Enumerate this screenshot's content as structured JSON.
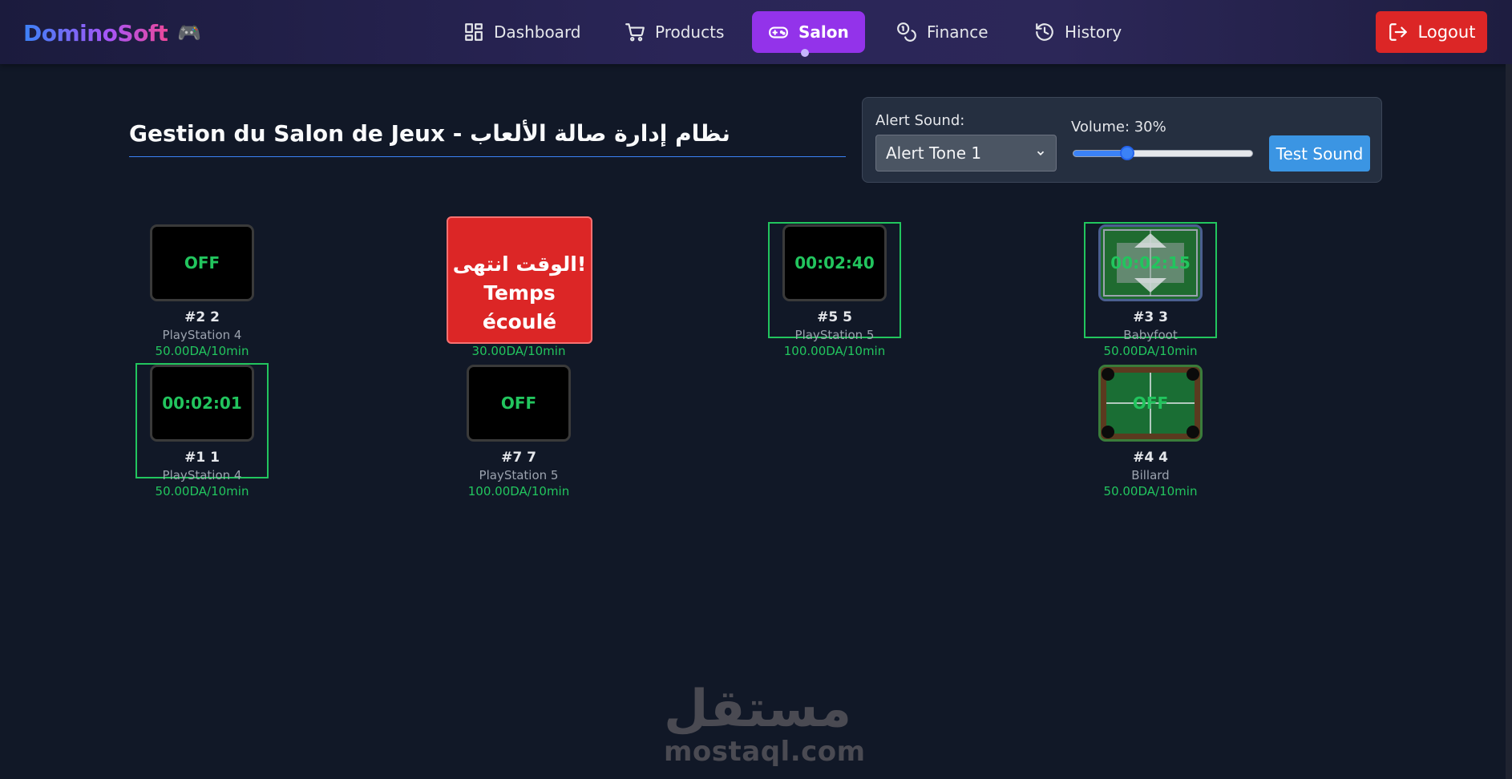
{
  "brand": {
    "name": "DominoSoft",
    "icon": "gamepad-icon"
  },
  "nav": {
    "items": [
      {
        "label": "Dashboard",
        "icon": "dashboard-icon"
      },
      {
        "label": "Products",
        "icon": "cart-icon"
      },
      {
        "label": "Salon",
        "icon": "gamepad-icon",
        "active": true
      },
      {
        "label": "Finance",
        "icon": "coins-icon"
      },
      {
        "label": "History",
        "icon": "history-icon"
      }
    ],
    "logout_label": "Logout"
  },
  "page_title": "Gestion du Salon de Jeux - نظام إدارة صالة الألعاب",
  "sound": {
    "alert_label": "Alert Sound:",
    "alert_value": "Alert Tone 1",
    "volume_label": "Volume: 30%",
    "volume_percent": 30,
    "test_label": "Test Sound"
  },
  "stations": [
    {
      "id": "2",
      "name": "#2 2",
      "type": "PlayStation 4",
      "price": "50.00DA/10min",
      "display": "OFF"
    },
    {
      "id": "6",
      "name": "",
      "type": "",
      "price": "30.00DA/10min",
      "display": "",
      "expired_text": "الوقت انتهى! Temps écoulé"
    },
    {
      "id": "5",
      "name": "#5 5",
      "type": "PlayStation 5",
      "price": "100.00DA/10min",
      "display": "00:02:40"
    },
    {
      "id": "3",
      "name": "#3 3",
      "type": "Babyfoot",
      "price": "50.00DA/10min",
      "display": "00:02:15"
    },
    {
      "id": "1",
      "name": "#1 1",
      "type": "PlayStation 4",
      "price": "50.00DA/10min",
      "display": "00:02:01"
    },
    {
      "id": "7",
      "name": "#7 7",
      "type": "PlayStation 5",
      "price": "100.00DA/10min",
      "display": "OFF"
    },
    {
      "id": "4",
      "name": "#4 4",
      "type": "Billard",
      "price": "50.00DA/10min",
      "display": "OFF"
    }
  ],
  "watermark": {
    "arabic": "مستقل",
    "latin": "mostaql.com"
  },
  "colors": {
    "accent": "#9333ea",
    "active": "#22c55e",
    "danger": "#dc2626",
    "info": "#3b82f6"
  }
}
